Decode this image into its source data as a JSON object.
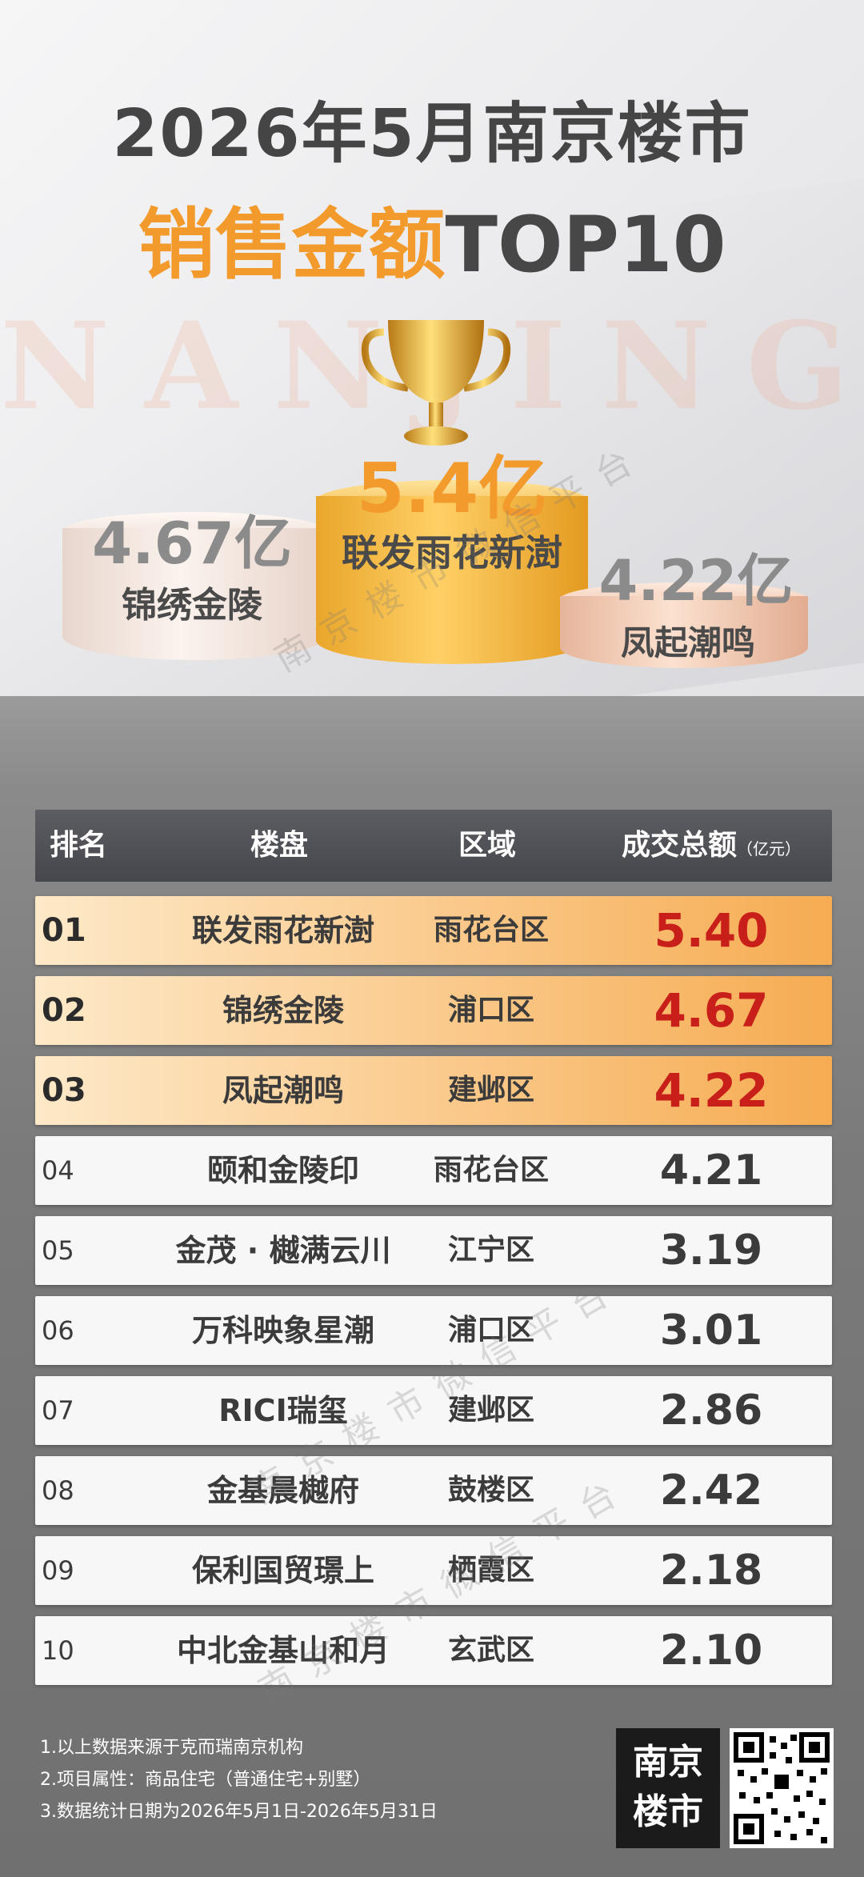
{
  "header": {
    "title_line1": "2026年5月南京楼市",
    "title_line2_orange": "销售金额",
    "title_line2_dark": "TOP10",
    "bg_word": "NANJING"
  },
  "podium": {
    "first": {
      "amount": "5.4亿",
      "name": "联发雨花新澍"
    },
    "second": {
      "amount": "4.67亿",
      "name": "锦绣金陵"
    },
    "third": {
      "amount": "4.22亿",
      "name": "凤起潮鸣"
    }
  },
  "table": {
    "headers": {
      "rank": "排名",
      "name": "楼盘",
      "area": "区域",
      "amount": "成交总额",
      "unit": "（亿元）"
    },
    "rows": [
      {
        "rank": "01",
        "name": "联发雨花新澍",
        "area": "雨花台区",
        "amount": "5.40"
      },
      {
        "rank": "02",
        "name": "锦绣金陵",
        "area": "浦口区",
        "amount": "4.67"
      },
      {
        "rank": "03",
        "name": "凤起潮鸣",
        "area": "建邺区",
        "amount": "4.22"
      },
      {
        "rank": "04",
        "name": "颐和金陵印",
        "area": "雨花台区",
        "amount": "4.21"
      },
      {
        "rank": "05",
        "name": "金茂 · 樾满云川",
        "area": "江宁区",
        "amount": "3.19"
      },
      {
        "rank": "06",
        "name": "万科映象星潮",
        "area": "浦口区",
        "amount": "3.01"
      },
      {
        "rank": "07",
        "name": "RICI瑞玺",
        "area": "建邺区",
        "amount": "2.86"
      },
      {
        "rank": "08",
        "name": "金基晨樾府",
        "area": "鼓楼区",
        "amount": "2.42"
      },
      {
        "rank": "09",
        "name": "保利国贸璟上",
        "area": "栖霞区",
        "amount": "2.18"
      },
      {
        "rank": "10",
        "name": "中北金基山和月",
        "area": "玄武区",
        "amount": "2.10"
      }
    ]
  },
  "notes": [
    "1.以上数据来源于克而瑞南京机构",
    "2.项目属性：商品住宅（普通住宅+别墅）",
    "3.数据统计日期为2026年5月1日-2026年5月31日"
  ],
  "logo": {
    "line1": "南京",
    "line2": "楼市"
  },
  "watermark": "南京楼市微信平台",
  "colors": {
    "orange": "#f39a2c",
    "red": "#c81f1a",
    "header_bg": "#4f5055"
  }
}
